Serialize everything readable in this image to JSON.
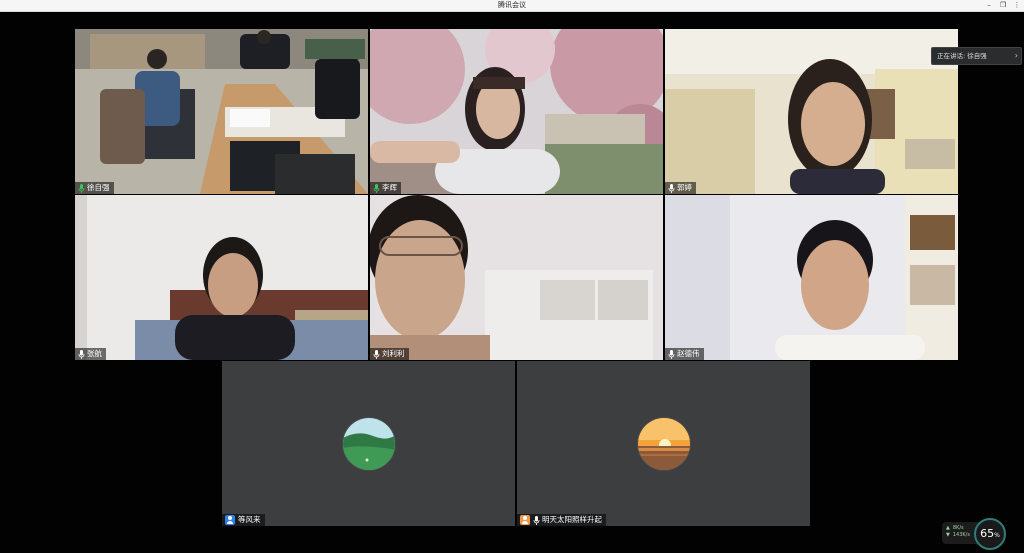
{
  "window": {
    "title": "腾讯会议"
  },
  "speaking": {
    "label": "正在讲话: 徐自强"
  },
  "participants": [
    {
      "name": "徐自强"
    },
    {
      "name": "李辉"
    },
    {
      "name": "郭婷"
    },
    {
      "name": "张航"
    },
    {
      "name": "刘利利"
    },
    {
      "name": "赵德伟"
    },
    {
      "name": "等风来"
    },
    {
      "name": "明天太阳照样升起"
    }
  ],
  "network": {
    "upload": "8K/s",
    "download": "143K/s"
  },
  "performance": {
    "value": "65",
    "unit": "%"
  },
  "colors": {
    "mic_active": "#3cc25a",
    "avatar_badge_blue": "#2f80ed",
    "avatar_badge_orange": "#f2994a"
  }
}
